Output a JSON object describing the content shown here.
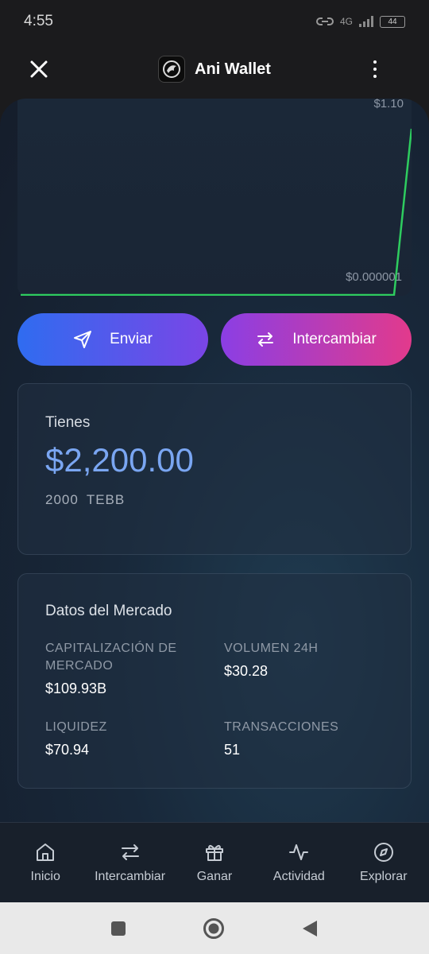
{
  "status_bar": {
    "time": "4:55",
    "network": "4G",
    "battery": "44"
  },
  "header": {
    "title": "Ani Wallet",
    "close_icon": "close-icon",
    "menu_icon": "more-vertical-icon"
  },
  "chart": {
    "max_label": "$1.10",
    "min_label": "$0.000001",
    "line_color": "#2ecc5f"
  },
  "chart_data": {
    "type": "line",
    "series": [
      {
        "values": [
          1e-06,
          1e-06,
          1e-06,
          1e-06,
          1e-06,
          1e-06,
          1e-06,
          1e-06,
          1e-06,
          1e-06,
          1e-06,
          1e-06,
          1e-06,
          1e-06,
          1e-06,
          1e-06,
          1e-06,
          1e-06,
          1e-06,
          1e-06,
          1.1
        ]
      }
    ],
    "ylim": [
      1e-06,
      1.1
    ],
    "grid": false
  },
  "actions": {
    "send_label": "Enviar",
    "swap_label": "Intercambiar"
  },
  "balance": {
    "label": "Tienes",
    "value": "$2,200.00",
    "amount": "2000",
    "symbol": "TEBB"
  },
  "market": {
    "title": "Datos del Mercado",
    "stats": [
      {
        "label": "CAPITALIZACIÓN DE MERCADO",
        "value": "$109.93B"
      },
      {
        "label": "VOLUMEN 24H",
        "value": "$30.28"
      },
      {
        "label": "LIQUIDEZ",
        "value": "$70.94"
      },
      {
        "label": "TRANSACCIONES",
        "value": "51"
      }
    ]
  },
  "nav": {
    "items": [
      {
        "label": "Inicio",
        "icon": "home-icon"
      },
      {
        "label": "Intercambiar",
        "icon": "swap-icon"
      },
      {
        "label": "Ganar",
        "icon": "gift-icon"
      },
      {
        "label": "Actividad",
        "icon": "activity-icon"
      },
      {
        "label": "Explorar",
        "icon": "compass-icon"
      }
    ]
  },
  "colors": {
    "accent_blue": "#7aa6f2",
    "send_gradient_start": "#2f6cf0",
    "swap_gradient_end": "#e23a8c"
  }
}
